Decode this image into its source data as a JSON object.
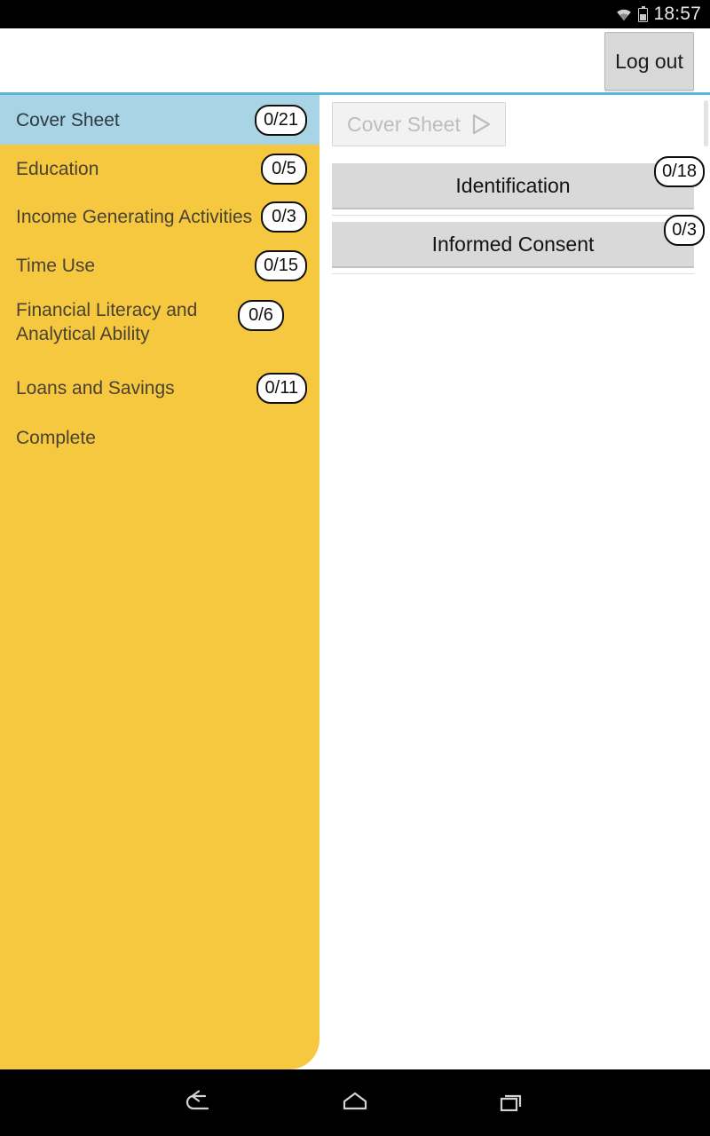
{
  "status_bar": {
    "time": "18:57",
    "wifi_icon": "wifi-icon",
    "battery_icon": "battery-icon"
  },
  "app_bar": {
    "logout_label": "Log out",
    "divider_color": "#5bb6d9"
  },
  "sidebar": {
    "background_color": "#f5c83f",
    "selected_color": "#a9d4e5",
    "items": [
      {
        "label": "Cover Sheet",
        "badge": "0/21",
        "selected": true
      },
      {
        "label": "Education",
        "badge": "0/5",
        "selected": false
      },
      {
        "label": "Income Generating Activities",
        "badge": "0/3",
        "selected": false
      },
      {
        "label": "Time Use",
        "badge": "0/15",
        "selected": false
      },
      {
        "label": "Financial Literacy and Analytical Ability",
        "badge": "0/6",
        "selected": false
      },
      {
        "label": "Loans and Savings",
        "badge": "0/11",
        "selected": false
      },
      {
        "label": "Complete",
        "badge": "",
        "selected": false
      }
    ]
  },
  "drawer_handle": {
    "chevron": ">"
  },
  "content": {
    "breadcrumb": {
      "label": "Cover Sheet",
      "icon": "play-triangle-icon"
    },
    "sections": [
      {
        "label": "Identification",
        "badge": "0/18"
      },
      {
        "label": "Informed Consent",
        "badge": "0/3"
      }
    ]
  },
  "nav_bar": {
    "back_icon": "back-arrow-icon",
    "home_icon": "home-icon",
    "recents_icon": "recent-apps-icon"
  }
}
